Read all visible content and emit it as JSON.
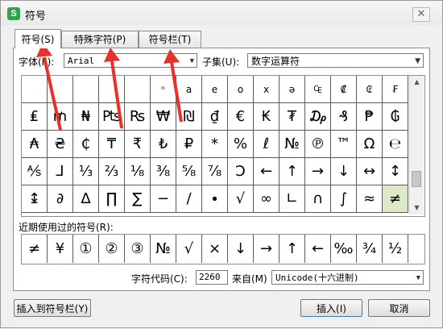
{
  "window": {
    "title": "符号",
    "close_glyph": "✕"
  },
  "tabs": [
    {
      "label": "符号(S)",
      "active": true
    },
    {
      "label": "特殊字符(P)",
      "active": false
    },
    {
      "label": "符号栏(T)",
      "active": false
    }
  ],
  "font": {
    "label": "字体(F):",
    "value": "Arial"
  },
  "subset": {
    "label": "子集(U):",
    "value": "数字运算符"
  },
  "symbol_grid": [
    [
      "",
      "",
      "",
      "",
      "",
      "ⁿ",
      "a",
      "e",
      "o",
      "x",
      "ə",
      "₠",
      "₡",
      "₢",
      "₣"
    ],
    [
      "₤",
      "₥",
      "₦",
      "₧",
      "₨",
      "₩",
      "₪",
      "₫",
      "€",
      "₭",
      "₮",
      "₯",
      "₰",
      "₱",
      "₲"
    ],
    [
      "₳",
      "₴",
      "₵",
      "₸",
      "₹",
      "₺",
      "₽",
      "*",
      "%",
      "ℓ",
      "№",
      "℗",
      "™",
      "Ω",
      "℮"
    ],
    [
      "⅍",
      "⅃",
      "⅓",
      "⅔",
      "⅛",
      "⅜",
      "⅝",
      "⅞",
      "Ↄ",
      "←",
      "↑",
      "→",
      "↓",
      "↔",
      "↕"
    ],
    [
      "↨",
      "∂",
      "∆",
      "∏",
      "∑",
      "−",
      "∕",
      "∙",
      "√",
      "∞",
      "∟",
      "∩",
      "∫",
      "≈",
      "≠"
    ]
  ],
  "selected_symbol": "≠",
  "recent": {
    "label": "近期使用过的符号(R):",
    "items": [
      "≠",
      "¥",
      "①",
      "②",
      "③",
      "№",
      "√",
      "×",
      "↓",
      "→",
      "↑",
      "←",
      "‰",
      "¾",
      "½"
    ]
  },
  "char_code": {
    "label": "字符代码(C):",
    "value": "2260"
  },
  "from": {
    "label": "来自(M)",
    "value": "Unicode(十六进制)"
  },
  "buttons": {
    "insert_to_bar": "插入到符号栏(Y)",
    "insert": "插入(I)",
    "cancel": "取消"
  },
  "annotation_color": "#e8312a"
}
